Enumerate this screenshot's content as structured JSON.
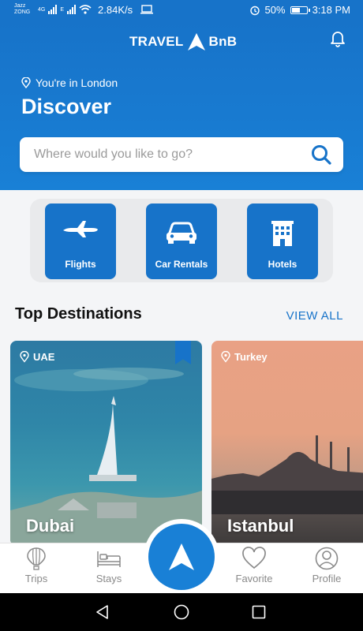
{
  "status_bar": {
    "carrier_1": "Jazz",
    "carrier_2": "ZONG",
    "net_1": "4G",
    "net_2": "E",
    "speed": "2.84K/s",
    "battery": "50%",
    "time": "3:18 PM"
  },
  "header": {
    "brand_left": "TRAVEL",
    "brand_right": "BnB",
    "location_text": "You're in London",
    "title": "Discover",
    "search_placeholder": "Where would you like to go?"
  },
  "categories": [
    {
      "label": "Flights",
      "icon": "airplane-icon"
    },
    {
      "label": "Car Rentals",
      "icon": "car-icon"
    },
    {
      "label": "Hotels",
      "icon": "hotel-icon"
    }
  ],
  "destinations": {
    "title": "Top Destinations",
    "view_all": "VIEW ALL",
    "cards": [
      {
        "country": "UAE",
        "city": "Dubai"
      },
      {
        "country": "Turkey",
        "city": "Istanbul"
      }
    ]
  },
  "bottom_nav": {
    "items": [
      {
        "label": "Trips",
        "icon": "balloon-icon"
      },
      {
        "label": "Stays",
        "icon": "bed-icon"
      },
      {
        "label": "Favorite",
        "icon": "heart-icon"
      },
      {
        "label": "Profile",
        "icon": "profile-icon"
      }
    ]
  },
  "colors": {
    "primary": "#1773c9",
    "nav_text": "#8a8a8a"
  }
}
